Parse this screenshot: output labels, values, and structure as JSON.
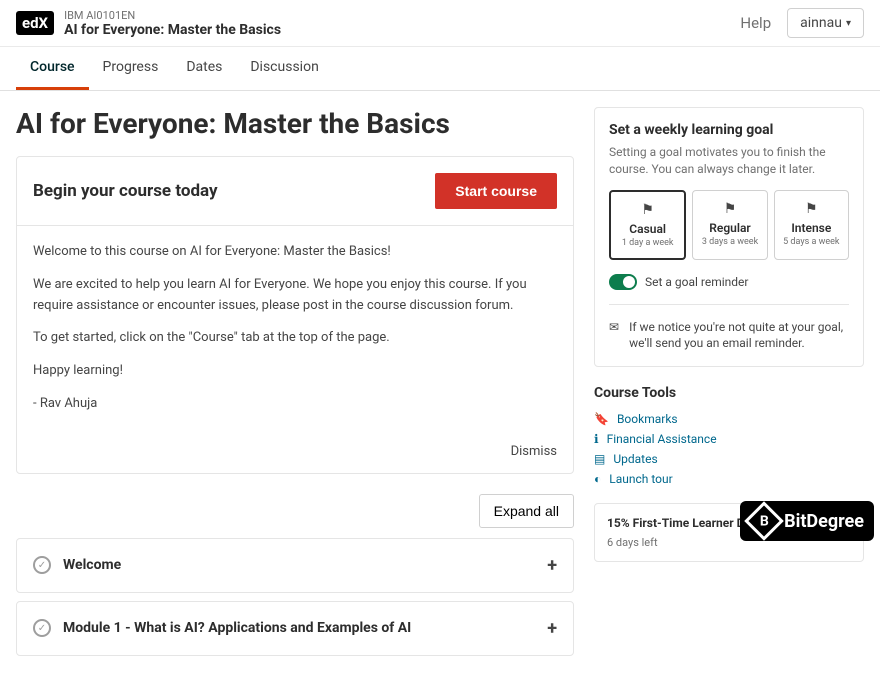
{
  "header": {
    "logo": "edX",
    "org_id": "IBM AI0101EN",
    "course_title": "AI for Everyone: Master the Basics",
    "help": "Help",
    "username": "ainnau"
  },
  "tabs": [
    {
      "label": "Course",
      "active": true
    },
    {
      "label": "Progress",
      "active": false
    },
    {
      "label": "Dates",
      "active": false
    },
    {
      "label": "Discussion",
      "active": false
    }
  ],
  "main": {
    "page_title": "AI for Everyone: Master the Basics",
    "begin_title": "Begin your course today",
    "start_label": "Start course",
    "welcome_p1": "Welcome to this course on AI for Everyone: Master the Basics!",
    "welcome_p2": "We are excited to help you learn AI for Everyone. We hope you enjoy this course. If you require assistance or encounter issues, please post in the course discussion forum.",
    "welcome_p3": "To get started, click on the \"Course\" tab at the top of the page.",
    "welcome_p4": "Happy learning!",
    "welcome_sig": "- Rav Ahuja",
    "dismiss": "Dismiss",
    "expand_all": "Expand all",
    "sections": [
      {
        "title": "Welcome"
      },
      {
        "title": "Module 1 - What is AI? Applications and Examples of AI"
      }
    ]
  },
  "sidebar": {
    "goal_title": "Set a weekly learning goal",
    "goal_desc": "Setting a goal motivates you to finish the course. You can always change it later.",
    "options": [
      {
        "name": "Casual",
        "days": "1 day a week",
        "selected": true
      },
      {
        "name": "Regular",
        "days": "3 days a week",
        "selected": false
      },
      {
        "name": "Intense",
        "days": "5 days a week",
        "selected": false
      }
    ],
    "reminder_label": "Set a goal reminder",
    "notice_text": "If we notice you're not quite at your goal, we'll send you an email reminder.",
    "tools_title": "Course Tools",
    "tools": [
      {
        "label": "Bookmarks",
        "icon": "bookmark-icon"
      },
      {
        "label": "Financial Assistance",
        "icon": "info-icon"
      },
      {
        "label": "Updates",
        "icon": "newspaper-icon"
      },
      {
        "label": "Launch tour",
        "icon": "tour-icon"
      }
    ],
    "promo_title": "15% First-Time Learner Discount",
    "promo_sub": "6 days left"
  },
  "watermark": "BitDegree"
}
